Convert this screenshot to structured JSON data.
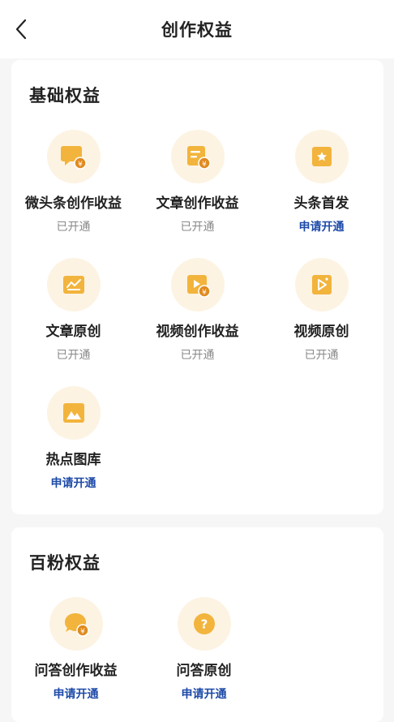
{
  "header": {
    "title": "创作权益"
  },
  "sections": [
    {
      "title": "基础权益",
      "items": [
        {
          "name": "微头条创作收益",
          "status": "已开通",
          "icon": "chat-bubble-yuan-icon"
        },
        {
          "name": "文章创作收益",
          "status": "已开通",
          "icon": "article-yuan-icon"
        },
        {
          "name": "头条首发",
          "status": "申请开通",
          "icon": "star-badge-icon"
        },
        {
          "name": "文章原创",
          "status": "已开通",
          "icon": "chart-screen-icon"
        },
        {
          "name": "视频创作收益",
          "status": "已开通",
          "icon": "video-yuan-icon"
        },
        {
          "name": "视频原创",
          "status": "已开通",
          "icon": "video-original-icon"
        },
        {
          "name": "热点图库",
          "status": "申请开通",
          "icon": "image-gallery-icon"
        }
      ]
    },
    {
      "title": "百粉权益",
      "items": [
        {
          "name": "问答创作收益",
          "status": "申请开通",
          "icon": "qa-bubble-yuan-icon"
        },
        {
          "name": "问答原创",
          "status": "申请开通",
          "icon": "question-circle-icon"
        }
      ]
    }
  ],
  "colors": {
    "accent_orange": "#f2b43c",
    "apply_blue": "#1d4aa8",
    "icon_bg": "#fdf3e3"
  }
}
